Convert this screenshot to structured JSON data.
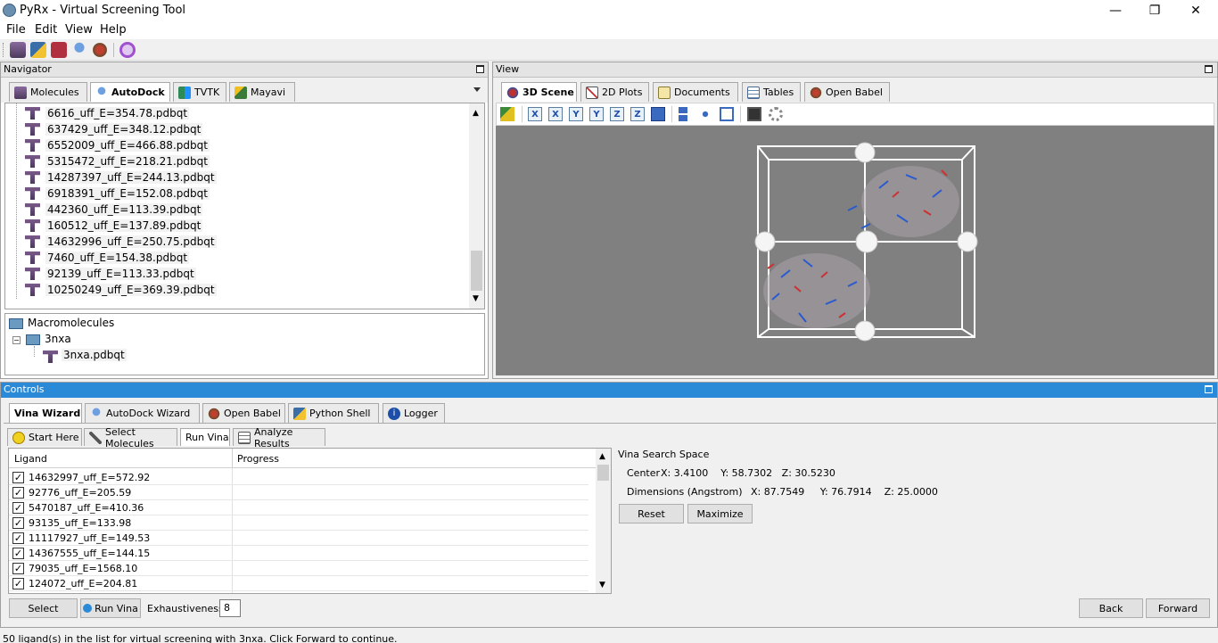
{
  "window": {
    "title": "PyRx - Virtual Screening Tool",
    "minimize": "—",
    "maximize": "❐",
    "close": "✕"
  },
  "menu": [
    "File",
    "Edit",
    "View",
    "Help"
  ],
  "navigator": {
    "header": "Navigator",
    "tabs": [
      "Molecules",
      "AutoDock",
      "TVTK",
      "Mayavi"
    ],
    "active_tab": "AutoDock",
    "ligands": [
      "6616_uff_E=354.78.pdbqt",
      "637429_uff_E=348.12.pdbqt",
      "6552009_uff_E=466.88.pdbqt",
      "5315472_uff_E=218.21.pdbqt",
      "14287397_uff_E=244.13.pdbqt",
      "6918391_uff_E=152.08.pdbqt",
      "442360_uff_E=113.39.pdbqt",
      "160512_uff_E=137.89.pdbqt",
      "14632996_uff_E=250.75.pdbqt",
      "7460_uff_E=154.38.pdbqt",
      "92139_uff_E=113.33.pdbqt",
      "10250249_uff_E=369.39.pdbqt"
    ],
    "macromolecules": {
      "label": "Macromolecules",
      "item": "3nxa",
      "file": "3nxa.pdbqt"
    }
  },
  "view": {
    "header": "View",
    "tabs": [
      "3D Scene",
      "2D Plots",
      "Documents",
      "Tables",
      "Open Babel"
    ],
    "active_tab": "3D Scene",
    "toolbar_axis_buttons": [
      "X",
      "X",
      "Y",
      "Y",
      "Z",
      "Z"
    ],
    "scene_bg": "#808080"
  },
  "controls": {
    "header": "Controls",
    "tabs": [
      "Vina Wizard",
      "AutoDock Wizard",
      "Open Babel",
      "Python Shell",
      "Logger"
    ],
    "active_tab": "Vina Wizard",
    "subtabs": [
      "Start Here",
      "Select Molecules",
      "Run Vina",
      "Analyze Results"
    ],
    "active_subtab": "Run Vina",
    "table": {
      "columns": [
        "Ligand",
        "Progress"
      ],
      "rows": [
        "14632997_uff_E=572.92",
        "92776_uff_E=205.59",
        "5470187_uff_E=410.36",
        "93135_uff_E=133.98",
        "11117927_uff_E=149.53",
        "14367555_uff_E=144.15",
        "79035_uff_E=1568.10",
        "124072_uff_E=204.81"
      ]
    },
    "search_space": {
      "title": "Vina Search Space",
      "center_label": "Center",
      "center": "X: 3.4100    Y: 58.7302   Z: 30.5230",
      "dimensions_label": "Dimensions (Angstrom)",
      "dimensions": "X: 87.7549     Y: 76.7914    Z: 25.0000",
      "reset": "Reset",
      "maximize": "Maximize"
    },
    "select_button": "Select",
    "run_button": "Run Vina",
    "exhaustiveness_label": "Exhaustiveness:",
    "exhaustiveness_value": "8",
    "back": "Back",
    "forward": "Forward"
  },
  "status": "50 ligand(s) in the list for virtual screening with 3nxa. Click Forward to continue."
}
